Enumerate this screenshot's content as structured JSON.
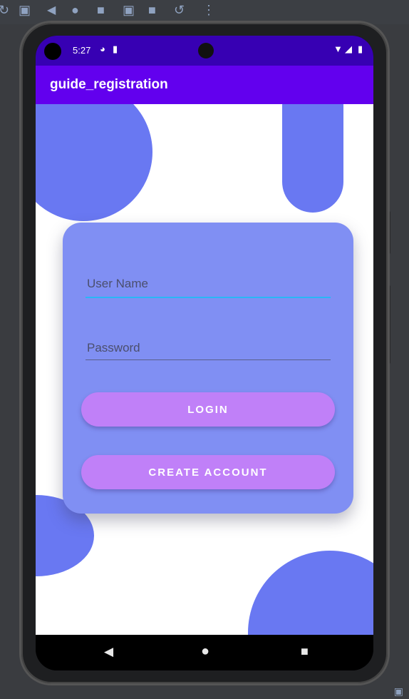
{
  "emulator_toolbar": {
    "icons": [
      "debug-icon",
      "window-icon",
      "back-icon",
      "home-icon",
      "stop-icon",
      "camera-icon",
      "record-icon",
      "rotate-icon",
      "more-icon"
    ]
  },
  "status_bar": {
    "time": "5:27",
    "icons": [
      "sync-icon",
      "sd-card-icon",
      "wifi-icon",
      "signal-icon",
      "battery-icon"
    ]
  },
  "app_bar": {
    "title": "guide_registration"
  },
  "login_form": {
    "username_placeholder": "User Name",
    "password_placeholder": "Password",
    "login_label": "LOGIN",
    "create_account_label": "CREATE ACCOUNT"
  },
  "nav_bar": {
    "icons": [
      "nav-back-icon",
      "nav-home-icon",
      "nav-recents-icon"
    ]
  },
  "colors": {
    "status_bar": "#3700b3",
    "app_bar": "#6200ee",
    "card": "#808ff3",
    "blob": "#6978f2",
    "button": "#c080f8",
    "focus_underline": "#29b6f6"
  }
}
